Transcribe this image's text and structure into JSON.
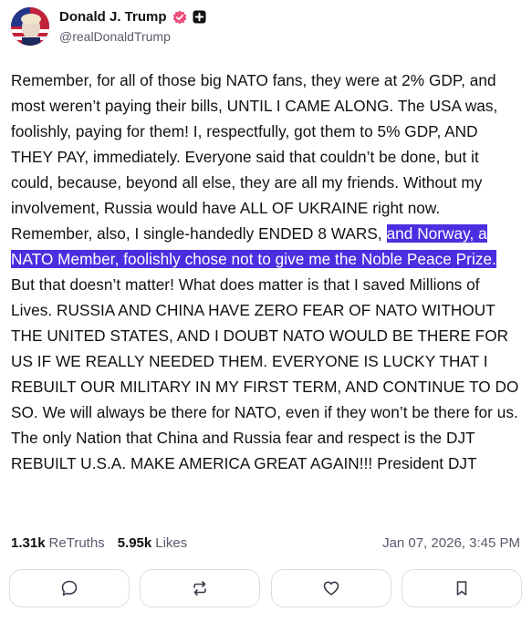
{
  "author": {
    "name": "Donald J. Trump",
    "handle": "@realDonaldTrump"
  },
  "post": {
    "text_before": "Remember, for all of those big NATO fans, they were at 2% GDP, and most weren’t paying their bills, UNTIL I CAME ALONG. The USA was, foolishly, paying for them! I, respectfully, got them to 5% GDP, AND THEY PAY, immediately. Everyone said that couldn’t be done, but it could, because, beyond all else, they are all my friends. Without my involvement, Russia would have ALL OF UKRAINE right now. Remember, also, I single-handedly ENDED 8 WARS, ",
    "text_highlighted": "and Norway, a NATO Member, foolishly chose not to give me the Noble Peace Prize.",
    "text_after": " But that doesn’t matter! What does matter is that I saved Millions of Lives. RUSSIA AND CHINA HAVE ZERO FEAR OF NATO WITHOUT THE UNITED STATES, AND I DOUBT NATO WOULD BE THERE FOR US IF WE REALLY NEEDED THEM. EVERYONE IS LUCKY THAT I REBUILT OUR MILITARY IN MY FIRST TERM, AND CONTINUE TO DO SO. We will always be there for NATO, even if they won’t be there for us. The only Nation that China and Russia fear and respect is the DJT REBUILT U.S.A. MAKE AMERICA GREAT AGAIN!!! President DJT"
  },
  "stats": {
    "retruths_count": "1.31k",
    "retruths_label": "ReTruths",
    "likes_count": "5.95k",
    "likes_label": "Likes",
    "timestamp": "Jan 07, 2026, 3:45 PM"
  },
  "icons": {
    "verified": "verified-badge-icon",
    "plus": "plus-square-icon",
    "reply": "reply-bubble-icon",
    "retruth": "retruth-arrows-icon",
    "like": "heart-icon",
    "bookmark": "bookmark-icon"
  },
  "colors": {
    "highlight": "#4b2ee0",
    "verified": "#e8527a"
  }
}
